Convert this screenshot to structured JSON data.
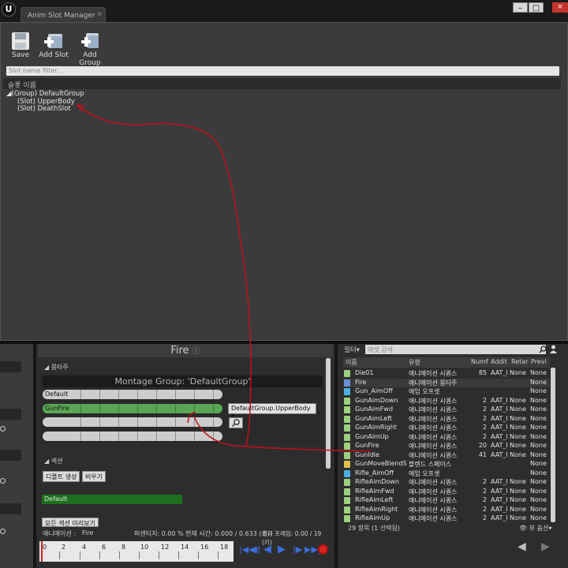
{
  "window": {
    "tab_title": "Anim Slot Manager",
    "tab_close": "×",
    "minimize": "–",
    "maximize": "□",
    "close": "×"
  },
  "toolbar": {
    "save": "Save",
    "add_slot": "Add Slot",
    "add_group": "Add Group"
  },
  "slot_filter": {
    "placeholder": "Slot name filter..."
  },
  "slot_list": {
    "header": "슬롯 이름",
    "group": "(Group) DefaultGroup",
    "slots": [
      "(Slot) UpperBody",
      "(Slot) DeathSlot"
    ]
  },
  "montage": {
    "title": "Fire",
    "montage_section": "몽타주",
    "group_title": "Montage Group: 'DefaultGroup'",
    "tracks": [
      "Default",
      "GunFire",
      "",
      ""
    ],
    "slot_select": "DefaultGroup.UpperBody",
    "sections_label": "섹션",
    "create_default": "디폴트 생성",
    "clear": "비우기",
    "default_section": "Default",
    "preview_all": "모든 섹션 미리보기"
  },
  "status": {
    "anim_label": "애니메이션 :",
    "anim_value": "Fire",
    "percent": "퍼센티지: 0.00 %",
    "time": "현재 시간: 0.000 / 0.633 (초)",
    "frame": "현재 프레임: 0.00 / 19 (키)"
  },
  "timeline": {
    "ticks": [
      "0",
      "2",
      "4",
      "6",
      "8",
      "10",
      "12",
      "14",
      "16",
      "18"
    ]
  },
  "browser": {
    "filter": "필터▾",
    "search_placeholder": "애셋 검색",
    "columns": [
      "이름",
      "유형",
      "Numf",
      "Addit",
      "Retar",
      "Previ"
    ],
    "rows": [
      {
        "name": "Die01",
        "type": "애니메이션 시퀀스",
        "num": "85",
        "add": "AAT_I",
        "ret": "None",
        "prev": "None",
        "color": "#9ccf7e"
      },
      {
        "name": "Fire",
        "type": "애니메이션 몽타주",
        "num": "",
        "add": "",
        "ret": "",
        "prev": "None",
        "color": "#6a8fd6"
      },
      {
        "name": "Gun_AimOff",
        "type": "에임 오프셋",
        "num": "",
        "add": "",
        "ret": "",
        "prev": "None",
        "color": "#4ab0e0"
      },
      {
        "name": "GunAimDown",
        "type": "애니메이션 시퀀스",
        "num": "2",
        "add": "AAT_I",
        "ret": "None",
        "prev": "None",
        "color": "#9ccf7e"
      },
      {
        "name": "GunAimFwd",
        "type": "애니메이션 시퀀스",
        "num": "2",
        "add": "AAT_I",
        "ret": "None",
        "prev": "None",
        "color": "#9ccf7e"
      },
      {
        "name": "GunAimLeft",
        "type": "애니메이션 시퀀스",
        "num": "2",
        "add": "AAT_I",
        "ret": "None",
        "prev": "None",
        "color": "#9ccf7e"
      },
      {
        "name": "GunAimRight",
        "type": "애니메이션 시퀀스",
        "num": "2",
        "add": "AAT_I",
        "ret": "None",
        "prev": "None",
        "color": "#9ccf7e"
      },
      {
        "name": "GunAimUp",
        "type": "애니메이션 시퀀스",
        "num": "2",
        "add": "AAT_I",
        "ret": "None",
        "prev": "None",
        "color": "#9ccf7e"
      },
      {
        "name": "GunFire",
        "type": "애니메이션 시퀀스",
        "num": "20",
        "add": "AAT_I",
        "ret": "None",
        "prev": "None",
        "color": "#9ccf7e"
      },
      {
        "name": "GunIdle",
        "type": "애니메이션 시퀀스",
        "num": "41",
        "add": "AAT_I",
        "ret": "None",
        "prev": "None",
        "color": "#9ccf7e"
      },
      {
        "name": "GunMoveBlendS",
        "type": "블렌드 스페이스",
        "num": "",
        "add": "",
        "ret": "",
        "prev": "None",
        "color": "#e0c050"
      },
      {
        "name": "Rifle_AimOff",
        "type": "에임 오프셋",
        "num": "",
        "add": "",
        "ret": "",
        "prev": "None",
        "color": "#4ab0e0"
      },
      {
        "name": "RifleAimDown",
        "type": "애니메이션 시퀀스",
        "num": "2",
        "add": "AAT_I",
        "ret": "None",
        "prev": "None",
        "color": "#9ccf7e"
      },
      {
        "name": "RifleAimFwd",
        "type": "애니메이션 시퀀스",
        "num": "2",
        "add": "AAT_I",
        "ret": "None",
        "prev": "None",
        "color": "#9ccf7e"
      },
      {
        "name": "RifleAimLeft",
        "type": "애니메이션 시퀀스",
        "num": "2",
        "add": "AAT_I",
        "ret": "None",
        "prev": "None",
        "color": "#9ccf7e"
      },
      {
        "name": "RifleAimRight",
        "type": "애니메이션 시퀀스",
        "num": "2",
        "add": "AAT_I",
        "ret": "None",
        "prev": "None",
        "color": "#9ccf7e"
      },
      {
        "name": "RifleAimUp",
        "type": "애니메이션 시퀀스",
        "num": "2",
        "add": "AAT_I",
        "ret": "None",
        "prev": "None",
        "color": "#9ccf7e"
      }
    ],
    "footer": "29 항목 (1 선택됨)",
    "view_options": "뷰 옵션▾"
  }
}
